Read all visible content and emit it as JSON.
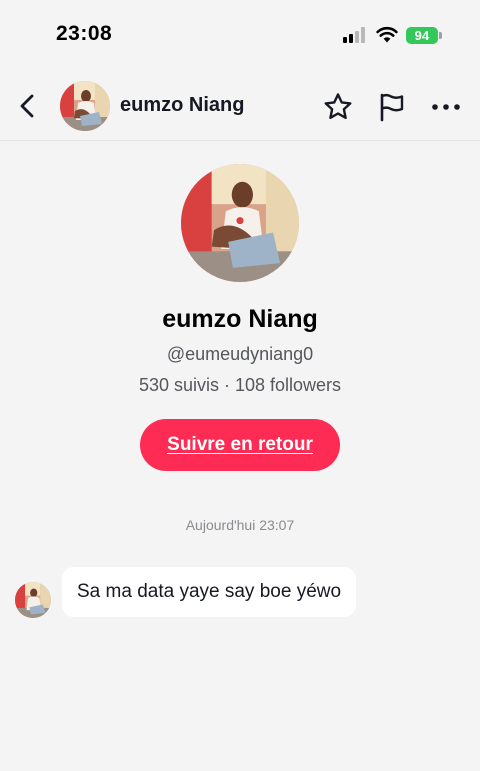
{
  "status_bar": {
    "time": "23:08",
    "battery": "94",
    "icons": [
      "signal-icon",
      "wifi-icon",
      "battery-icon"
    ]
  },
  "header": {
    "name": "eumzo Niang",
    "icons": [
      "chevron-left-icon",
      "star-icon",
      "flag-icon",
      "more-dots-icon"
    ]
  },
  "profile": {
    "name": "eumzo Niang",
    "handle": "@eumeudyniang0",
    "stats": "530 suivis · 108 followers",
    "follow_back_label": "Suivre en retour"
  },
  "conversation": {
    "timestamp": "Aujourd'hui 23:07",
    "messages": [
      {
        "text": "Sa ma data yaye say boe yéwo"
      }
    ]
  },
  "colors": {
    "accent": "#fe2c55",
    "background": "#f4f4f4",
    "battery": "#34c759",
    "muted_text": "#55575e"
  }
}
